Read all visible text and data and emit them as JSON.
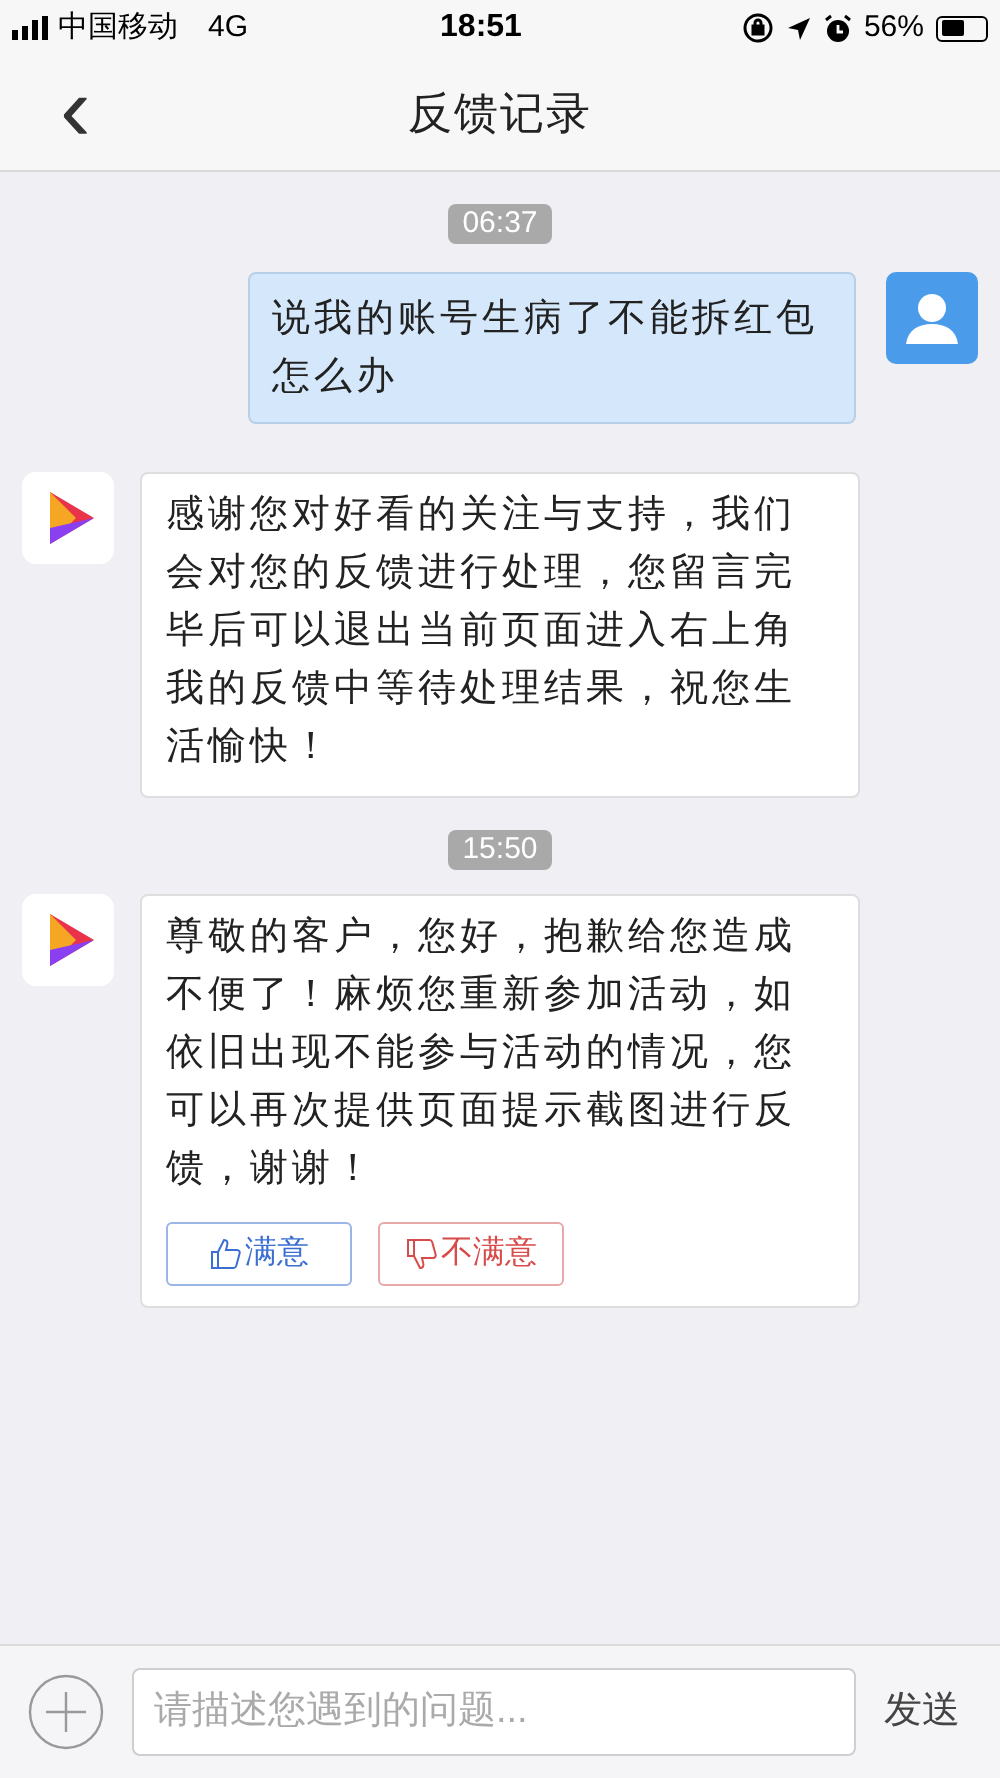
{
  "status_bar": {
    "carrier": "中国移动",
    "network": "4G",
    "time": "18:51",
    "battery": "56%"
  },
  "nav": {
    "back": "‹",
    "title": "反馈记录"
  },
  "messages": [
    {
      "kind": "time",
      "text": "06:37"
    },
    {
      "kind": "user",
      "text": "说我的账号生病了不能拆红包怎么办"
    },
    {
      "kind": "bot",
      "text": "感谢您对好看的关注与支持，我们会对您的反馈进行处理，您留言完毕后可以退出当前页面进入右上角我的反馈中等待处理结果，祝您生活愉快！"
    },
    {
      "kind": "time",
      "text": "15:50"
    },
    {
      "kind": "bot",
      "text": "尊敬的客户，您好，抱歉给您造成不便了！麻烦您重新参加活动，如依旧出现不能参与活动的情况，您可以再次提供页面提示截图进行反馈，谢谢！",
      "ratings": [
        {
          "kind": "like",
          "label": "满意"
        },
        {
          "kind": "dislike",
          "label": "不满意"
        }
      ]
    }
  ],
  "composer": {
    "placeholder": "请描述您遇到的问题...",
    "send": "发送"
  }
}
